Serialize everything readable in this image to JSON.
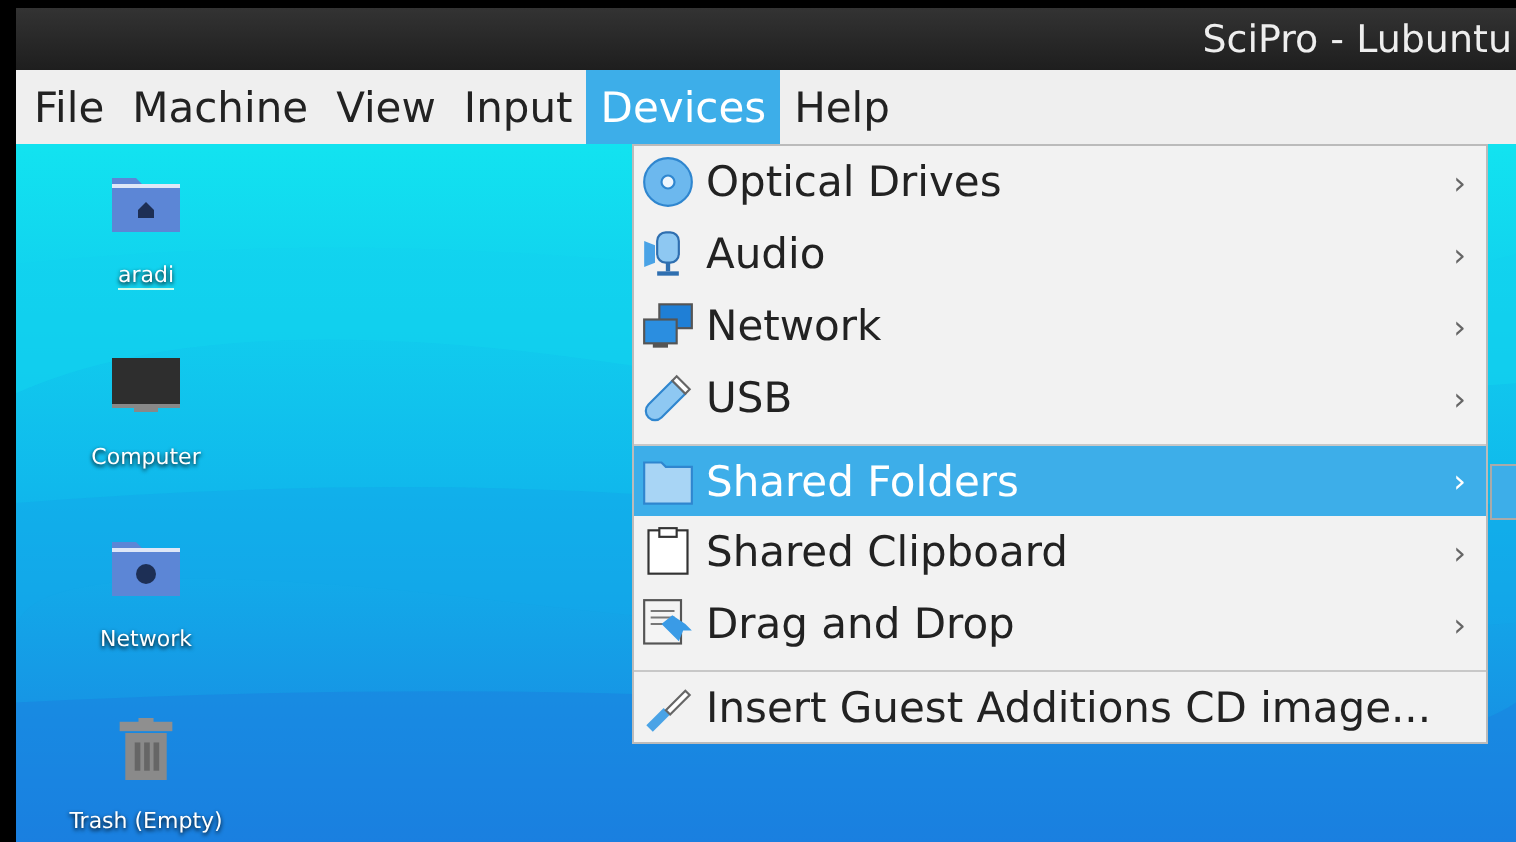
{
  "window": {
    "title": "SciPro - Lubuntu"
  },
  "menu_bar": [
    {
      "label": "File",
      "selected": false
    },
    {
      "label": "Machine",
      "selected": false
    },
    {
      "label": "View",
      "selected": false
    },
    {
      "label": "Input",
      "selected": false
    },
    {
      "label": "Devices",
      "selected": true
    },
    {
      "label": "Help",
      "selected": false
    }
  ],
  "devices_menu": [
    {
      "label": "Optical Drives",
      "arrow": "›",
      "selected": false,
      "separator_before": false
    },
    {
      "label": "Audio",
      "arrow": "›",
      "selected": false,
      "separator_before": false
    },
    {
      "label": "Network",
      "arrow": "›",
      "selected": false,
      "separator_before": false
    },
    {
      "label": "USB",
      "arrow": "›",
      "selected": false,
      "separator_before": false
    },
    {
      "label": "Shared Folders",
      "arrow": "›",
      "selected": true,
      "separator_before": true
    },
    {
      "label": "Shared Clipboard",
      "arrow": "›",
      "selected": false,
      "separator_before": false
    },
    {
      "label": "Drag and Drop",
      "arrow": "›",
      "selected": false,
      "separator_before": false
    },
    {
      "label": "Insert Guest Additions CD image...",
      "selected": false,
      "separator_before": true
    }
  ],
  "desktop_icons": [
    {
      "label": "aradi",
      "selected": true
    },
    {
      "label": "Computer",
      "selected": false
    },
    {
      "label": "Network",
      "selected": false
    },
    {
      "label": "Trash (Empty)",
      "selected": false
    }
  ]
}
